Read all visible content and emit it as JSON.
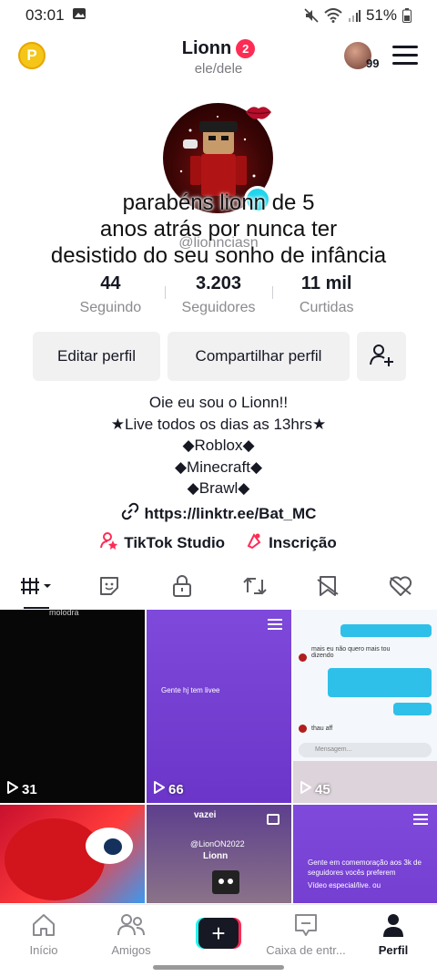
{
  "status": {
    "time": "03:01",
    "battery": "51%"
  },
  "header": {
    "username": "Lionn",
    "notif_count": "2",
    "pronouns": "ele/dele",
    "coin_letter": "P",
    "friends_count": "99"
  },
  "profile": {
    "handle": "@lionnciasn"
  },
  "overlay_caption": {
    "line1": "parabéns lionn de 5",
    "line2": "anos atrás por nunca ter",
    "line3": "desistido do seu sonho de infância"
  },
  "stats": [
    {
      "value": "44",
      "label": "Seguindo"
    },
    {
      "value": "3.203",
      "label": "Seguidores"
    },
    {
      "value": "11 mil",
      "label": "Curtidas"
    }
  ],
  "buttons": {
    "edit": "Editar perfil",
    "share": "Compartilhar perfil"
  },
  "bio": {
    "l1": "Oie eu sou o Lionn!!",
    "l2": "★Live todos os dias as 13hrs★",
    "l3": "◆Roblox◆",
    "l4": "◆Minecraft◆",
    "l5": "◆Brawl◆"
  },
  "link": "https://linktr.ee/Bat_MC",
  "tools": {
    "studio": "TikTok Studio",
    "subscription": "Inscrição"
  },
  "videos": [
    {
      "views": "31",
      "text": "molodra"
    },
    {
      "views": "66",
      "text": "Gente hj tem livee"
    },
    {
      "views": "45",
      "text": "Mensagem..."
    },
    {
      "views": "",
      "text": ""
    },
    {
      "views": "",
      "text": "vazei",
      "text2": "@LionON2022",
      "text3": "Lionn"
    },
    {
      "views": "",
      "text": "Gente em comemoração aos 3k de seguidores vocês preferem",
      "text2": "Vídeo especial/live.      ou"
    }
  ],
  "chat": {
    "msg1": "mais eu não quero mais tou dizendo",
    "msg2": "thau aff"
  },
  "nav": {
    "home": "Início",
    "friends": "Amigos",
    "inbox": "Caixa de entr...",
    "profile": "Perfil"
  },
  "colors": {
    "accent": "#fe2c55",
    "cyan": "#25f4ee",
    "text": "#161823"
  }
}
